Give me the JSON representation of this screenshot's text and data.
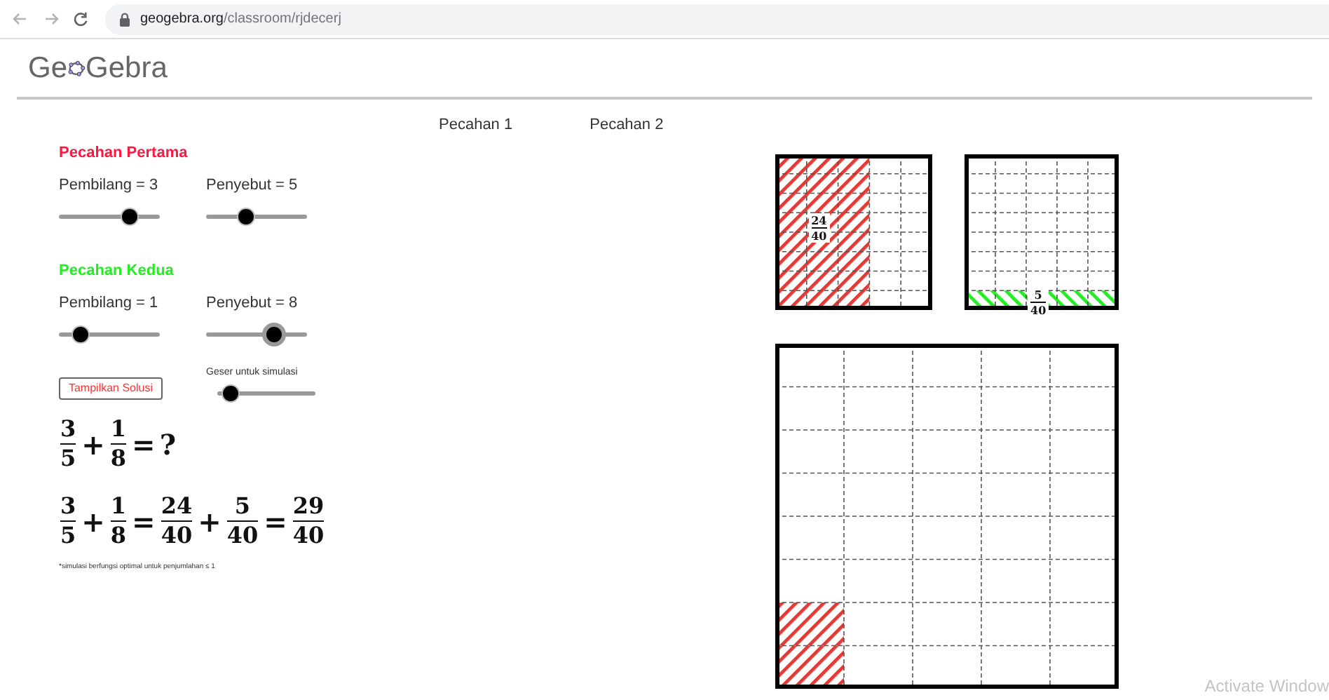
{
  "browser": {
    "url_host": "geogebra.org",
    "url_path": "/classroom/rjdecerj"
  },
  "header": {
    "logo_start": "Ge",
    "logo_end": "Gebra"
  },
  "tabs": [
    {
      "label": "Pecahan 1"
    },
    {
      "label": "Pecahan 2"
    }
  ],
  "sections": [
    {
      "title": "Pecahan Pertama",
      "color": "#ff1744",
      "sliders": [
        {
          "label": "Pembilang = 3",
          "level": 0.74,
          "focused": false
        },
        {
          "label": "Penyebut = 5",
          "level": 0.38,
          "focused": false
        }
      ]
    },
    {
      "title": "Pecahan Kedua",
      "color": "#22ee22",
      "sliders": [
        {
          "label": "Pembilang = 1",
          "level": 0.16,
          "focused": false
        },
        {
          "label": "Penyebut = 8",
          "level": 0.73,
          "focused": true
        }
      ]
    }
  ],
  "solution_button": {
    "label": "Tampilkan Solusi"
  },
  "simulation": {
    "label": "Geser untuk simulasi",
    "level": 0.05
  },
  "equations": [
    [
      {
        "kind": "frac",
        "num": "3",
        "den": "5"
      },
      {
        "kind": "op",
        "text": "+"
      },
      {
        "kind": "frac",
        "num": "1",
        "den": "8"
      },
      {
        "kind": "op",
        "text": "="
      },
      {
        "kind": "op",
        "text": "?"
      }
    ],
    [
      {
        "kind": "frac",
        "num": "3",
        "den": "5"
      },
      {
        "kind": "op",
        "text": "+"
      },
      {
        "kind": "frac",
        "num": "1",
        "den": "8"
      },
      {
        "kind": "op",
        "text": "="
      },
      {
        "kind": "frac",
        "num": "24",
        "den": "40"
      },
      {
        "kind": "op",
        "text": "+"
      },
      {
        "kind": "frac",
        "num": "5",
        "den": "40"
      },
      {
        "kind": "op",
        "text": "="
      },
      {
        "kind": "frac",
        "num": "29",
        "den": "40"
      }
    ]
  ],
  "footnote": "*simulasi berfungsi optimal untuk penjumlahan ≤ 1",
  "grids": [
    {
      "kind": "columns",
      "level": 0.6,
      "color": "#e53935",
      "label": {
        "num": "24",
        "den": "40"
      }
    },
    {
      "kind": "rows",
      "level": 0.125,
      "color": "#22ee22",
      "label": {
        "num": "5",
        "den": "40"
      }
    },
    {
      "kind": "cells",
      "level": 0.05,
      "color": "#e53935"
    }
  ],
  "os_notice": "Activate Window"
}
